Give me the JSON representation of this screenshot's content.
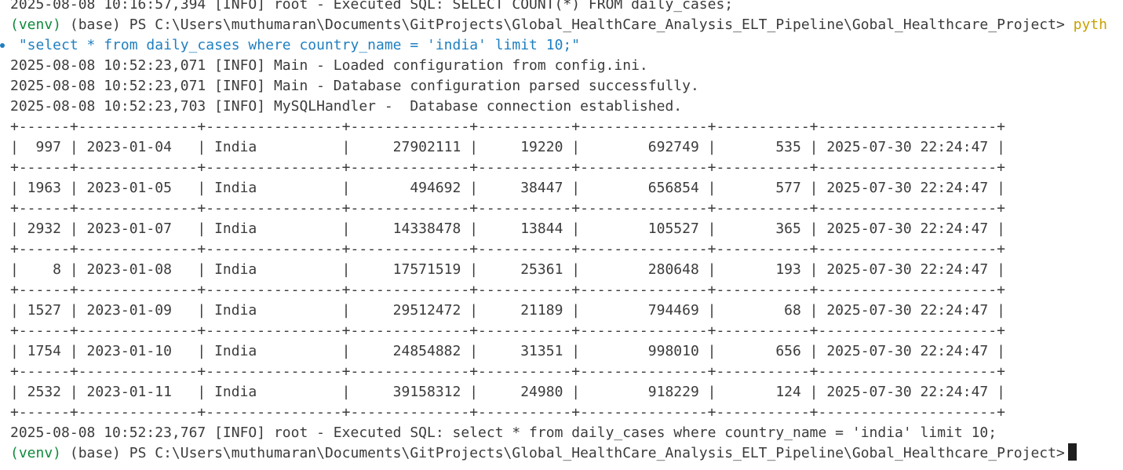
{
  "prev_log": "2025-08-08 10:16:57,394 [INFO] root - Executed SQL: SELECT COUNT(*) FROM daily_cases;",
  "prompt": {
    "venv": "(venv)",
    "base_path": " (base) PS C:\\Users\\muthumaran\\Documents\\GitProjects\\Global_HealthCare_Analysis_ELT_Pipeline\\Gobal_Healthcare_Project> ",
    "command": "pyth"
  },
  "query_arg": " \"select * from daily_cases where country_name = 'india' limit 10;\"",
  "logs": [
    "2025-08-08 10:52:23,071 [INFO] Main - Loaded configuration from config.ini.",
    "2025-08-08 10:52:23,071 [INFO] Main - Database configuration parsed successfully.",
    "2025-08-08 10:52:23,703 [INFO] MySQLHandler -  Database connection established."
  ],
  "table": {
    "rows": [
      [
        "997",
        "2023-01-04",
        "India",
        "27902111",
        "19220",
        "692749",
        "535",
        "2025-07-30 22:24:47"
      ],
      [
        "1963",
        "2023-01-05",
        "India",
        "494692",
        "38447",
        "656854",
        "577",
        "2025-07-30 22:24:47"
      ],
      [
        "2932",
        "2023-01-07",
        "India",
        "14338478",
        "13844",
        "105527",
        "365",
        "2025-07-30 22:24:47"
      ],
      [
        "8",
        "2023-01-08",
        "India",
        "17571519",
        "25361",
        "280648",
        "193",
        "2025-07-30 22:24:47"
      ],
      [
        "1527",
        "2023-01-09",
        "India",
        "29512472",
        "21189",
        "794469",
        "68",
        "2025-07-30 22:24:47"
      ],
      [
        "1754",
        "2023-01-10",
        "India",
        "24854882",
        "31351",
        "998010",
        "656",
        "2025-07-30 22:24:47"
      ],
      [
        "2532",
        "2023-01-11",
        "India",
        "39158312",
        "24980",
        "918229",
        "124",
        "2025-07-30 22:24:47"
      ]
    ]
  },
  "final_log": "2025-08-08 10:52:23,767 [INFO] root - Executed SQL: select * from daily_cases where country_name = 'india' limit 10;",
  "final_prompt": {
    "venv": "(venv)",
    "base_path": " (base) PS C:\\Users\\muthumaran\\Documents\\GitProjects\\Global_HealthCare_Analysis_ELT_Pipeline\\Gobal_Healthcare_Project>"
  },
  "colors": {
    "background": "#ffffff",
    "text": "#3b3b3b",
    "venv": "#0f8a3c",
    "command": "#c9a100",
    "string": "#1f7fc0"
  }
}
